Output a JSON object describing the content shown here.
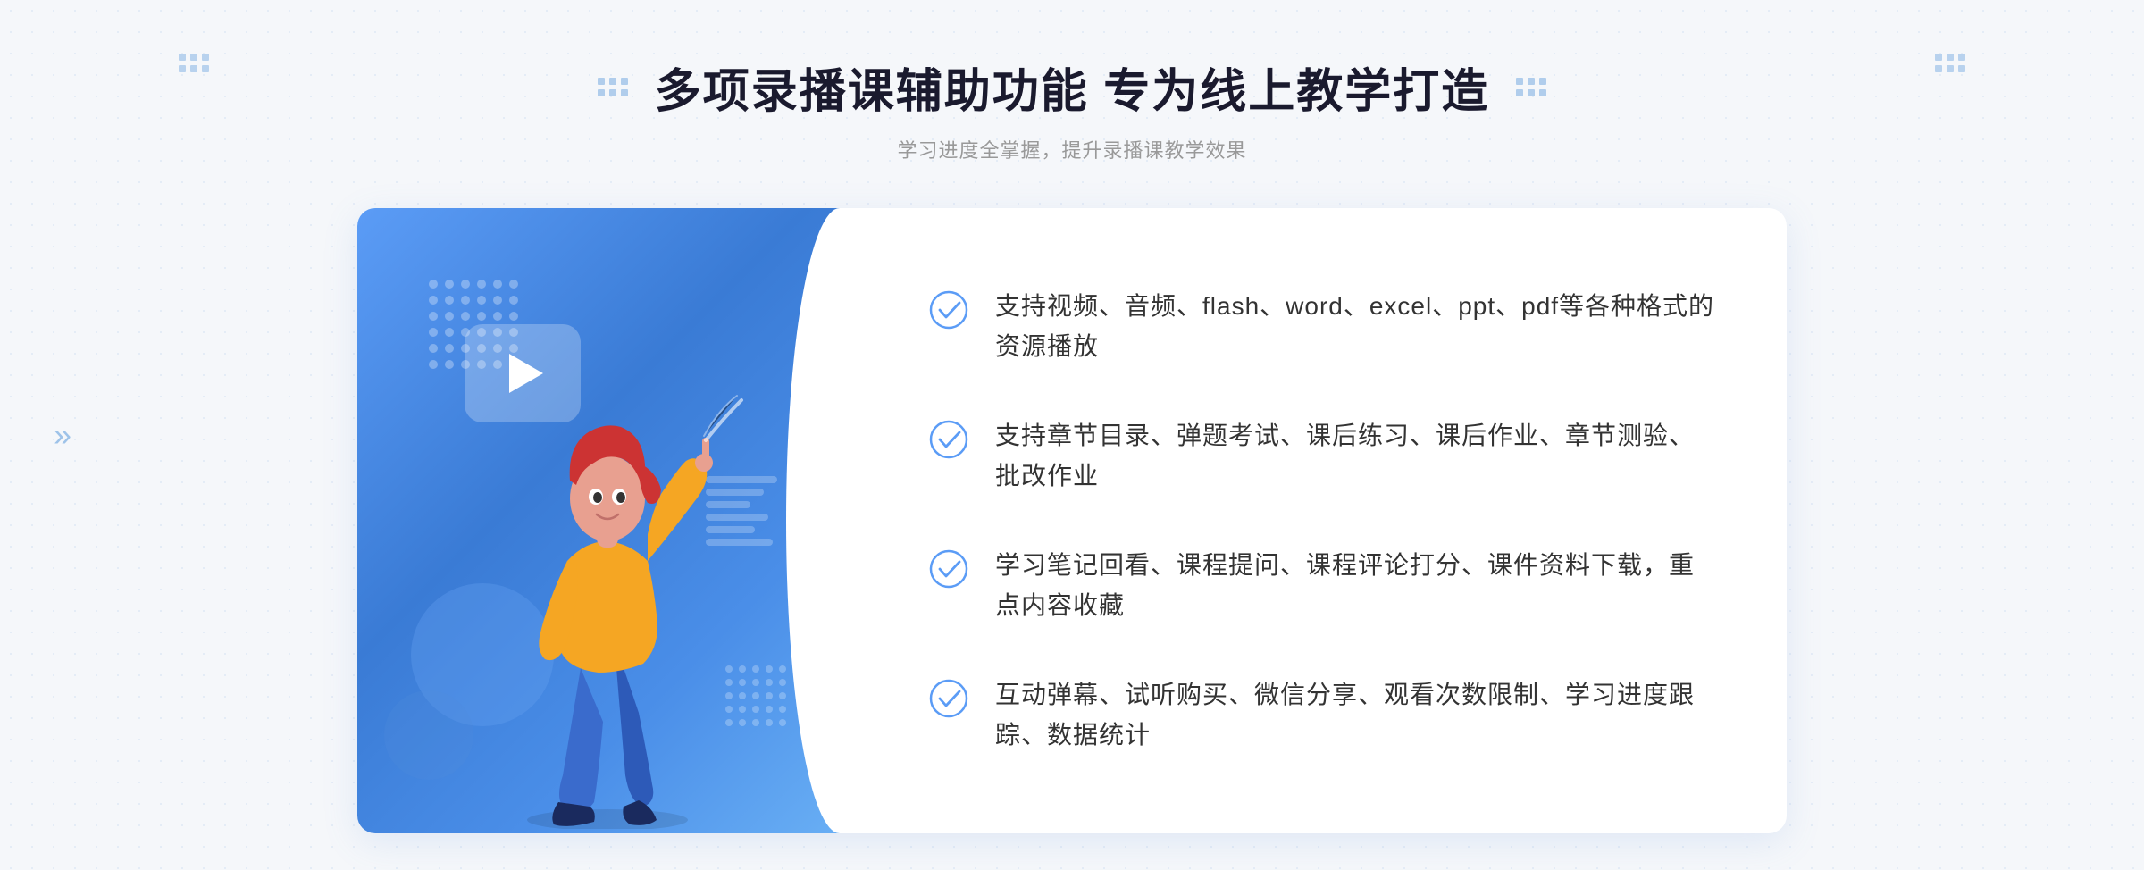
{
  "page": {
    "background_color": "#f5f7fa"
  },
  "header": {
    "main_title": "多项录播课辅助功能 专为线上教学打造",
    "sub_title": "学习进度全掌握，提升录播课教学效果"
  },
  "features": [
    {
      "id": "feature-1",
      "text": "支持视频、音频、flash、word、excel、ppt、pdf等各种格式的资源播放"
    },
    {
      "id": "feature-2",
      "text": "支持章节目录、弹题考试、课后练习、课后作业、章节测验、批改作业"
    },
    {
      "id": "feature-3",
      "text": "学习笔记回看、课程提问、课程评论打分、课件资料下载，重点内容收藏"
    },
    {
      "id": "feature-4",
      "text": "互动弹幕、试听购买、微信分享、观看次数限制、学习进度跟踪、数据统计"
    }
  ],
  "icons": {
    "check_circle": "check-circle-icon",
    "play": "play-icon",
    "arrows_left": "arrows-left-icon"
  },
  "colors": {
    "primary_blue": "#4a8ee8",
    "gradient_start": "#5b9cf6",
    "gradient_end": "#3a7bd5",
    "text_dark": "#1a1a2e",
    "text_gray": "#999999",
    "text_body": "#333333",
    "check_color": "#5b9cf6"
  }
}
